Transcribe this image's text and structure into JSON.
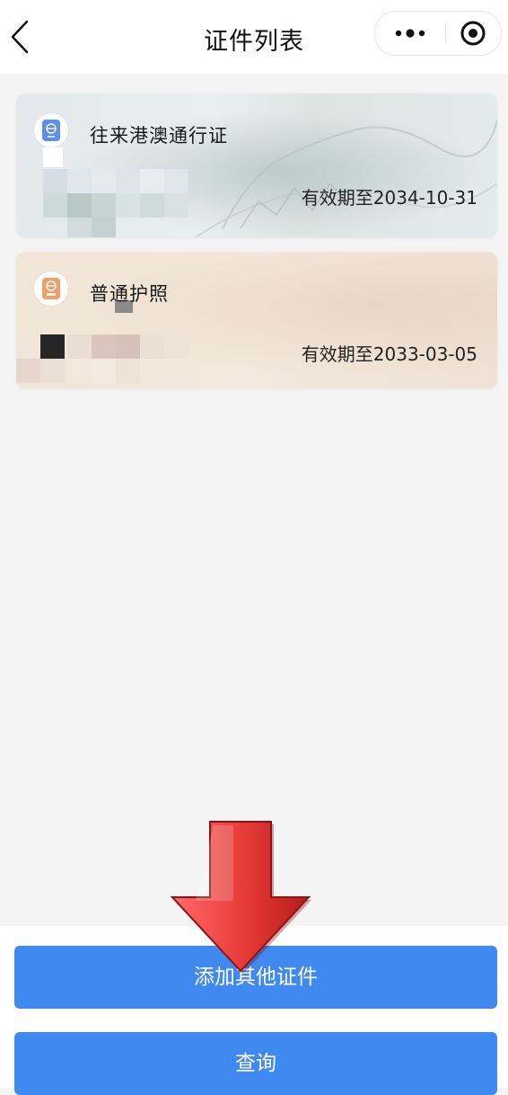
{
  "header": {
    "title": "证件列表",
    "back_icon": "chevron-left-icon",
    "more_icon": "more-dots-icon",
    "target_icon": "record-target-icon"
  },
  "cards": [
    {
      "title": "往来港澳通行证",
      "expiry": "有效期至2034-10-31",
      "icon": "hk-macao-permit-icon",
      "icon_color": "#5b8ef0"
    },
    {
      "title": "普通护照",
      "expiry": "有效期至2033-03-05",
      "icon": "passport-icon",
      "icon_color": "#f0a066"
    }
  ],
  "actions": {
    "add_label": "添加其他证件",
    "query_label": "查询"
  },
  "colors": {
    "primary": "#4089f1",
    "arrow_red": "#e53935"
  }
}
